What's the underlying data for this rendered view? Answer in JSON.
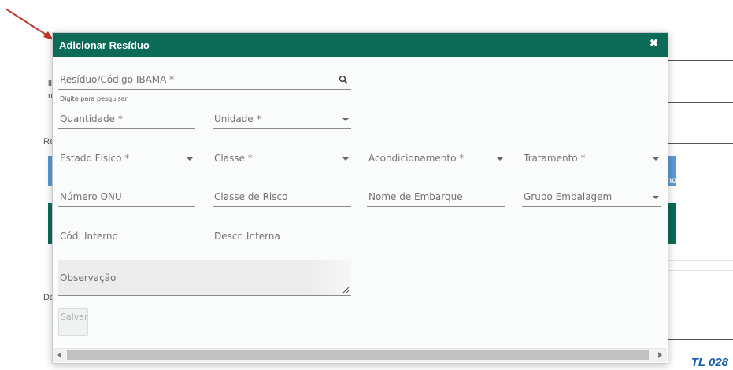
{
  "modal": {
    "title": "Adicionar Resíduo",
    "close_glyph": "✖",
    "fields": {
      "residuo": {
        "label": "Resíduo/Código IBAMA *",
        "hint": "Digite para pesquisar"
      },
      "quantidade": {
        "label": "Quantidade *"
      },
      "unidade": {
        "label": "Unidade *"
      },
      "estado_fisico": {
        "label": "Estado Físico *"
      },
      "classe": {
        "label": "Classe *"
      },
      "acondicionamento": {
        "label": "Acondicionamento *"
      },
      "tratamento": {
        "label": "Tratamento *"
      },
      "numero_onu": {
        "label": "Número ONU"
      },
      "classe_risco": {
        "label": "Classe de Risco"
      },
      "nome_embarque": {
        "label": "Nome de Embarque"
      },
      "grupo_embalagem": {
        "label": "Grupo Embalagem"
      },
      "cod_interno": {
        "label": "Cód. Interno"
      },
      "descr_interna": {
        "label": "Descr. Interna"
      },
      "observacao": {
        "label": "Observação"
      }
    },
    "save_label": "Salvar"
  },
  "background": {
    "fragments": [
      "ll",
      "m",
      "Re",
      "novo",
      "Da"
    ]
  },
  "footer_tag": "TL 028",
  "colors": {
    "header": "#0b6b57",
    "band_blue": "#5b9bd5",
    "band_green": "#0b6b57",
    "annotation_arrow": "#c0392b",
    "footer_tag": "#1b5ea8"
  }
}
